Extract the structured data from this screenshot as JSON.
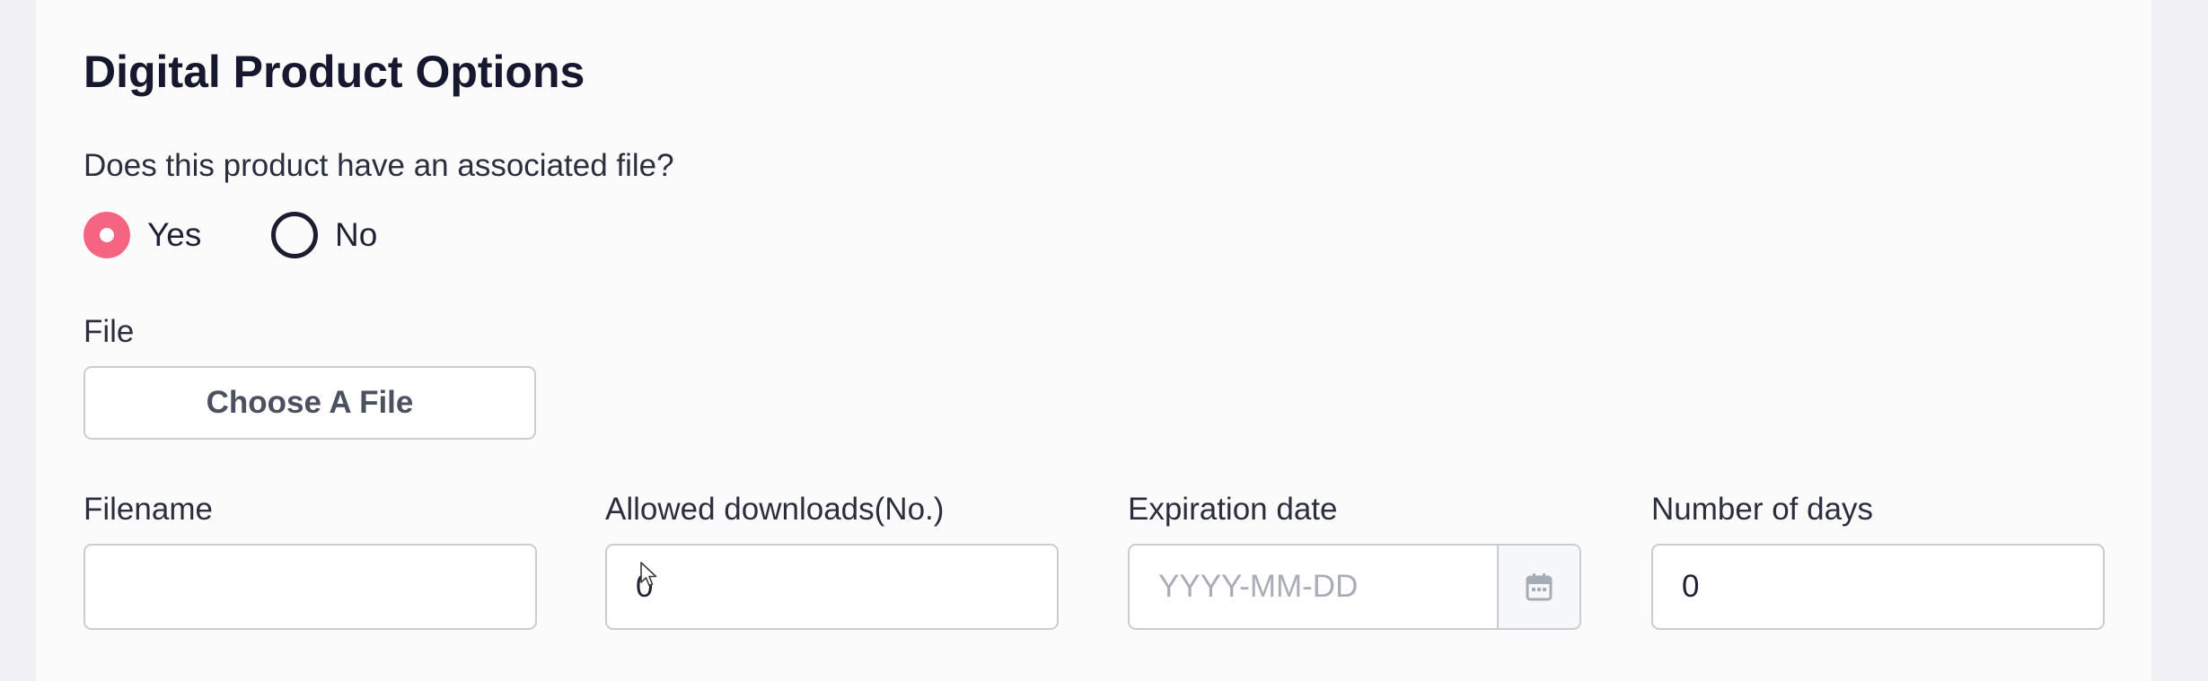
{
  "section": {
    "title": "Digital Product Options",
    "question": "Does this product have an associated file?"
  },
  "has_file": {
    "options": [
      {
        "label": "Yes",
        "selected": true
      },
      {
        "label": "No",
        "selected": false
      }
    ],
    "selected_color": "#f56480"
  },
  "file": {
    "label": "File",
    "button_label": "Choose A File"
  },
  "fields": {
    "filename": {
      "label": "Filename",
      "value": ""
    },
    "allowed_downloads": {
      "label": "Allowed downloads(No.)",
      "value": "0"
    },
    "expiration_date": {
      "label": "Expiration date",
      "placeholder": "YYYY-MM-DD",
      "value": "",
      "icon": "calendar-icon"
    },
    "number_of_days": {
      "label": "Number of days",
      "value": "0"
    }
  }
}
